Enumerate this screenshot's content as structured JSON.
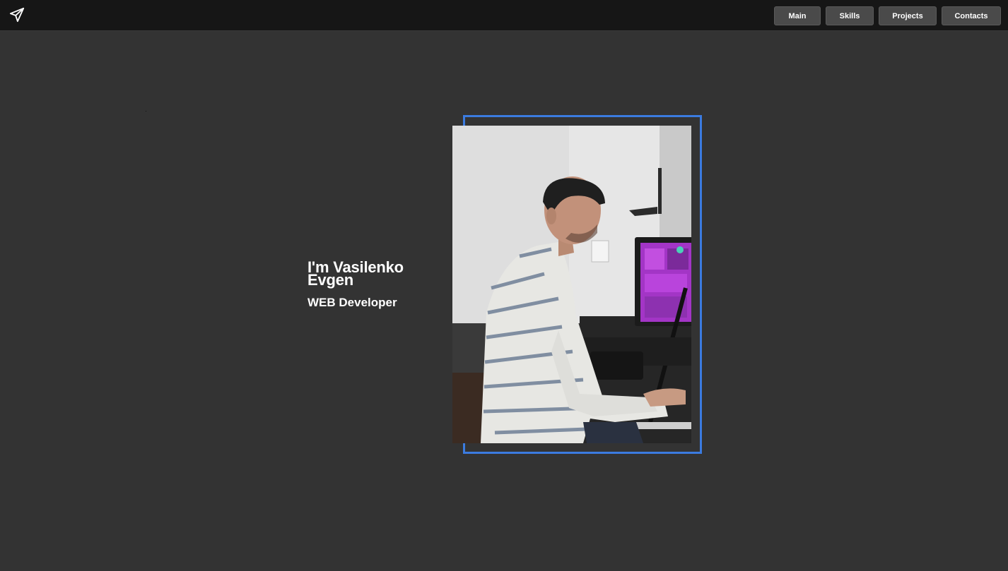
{
  "header": {
    "logo_icon": "paper-plane-icon",
    "nav": [
      {
        "label": "Main"
      },
      {
        "label": "Skills"
      },
      {
        "label": "Projects"
      },
      {
        "label": "Contacts"
      }
    ]
  },
  "hero": {
    "name": "I'm Vasilenko Evgen",
    "role": "WEB Developer"
  },
  "colors": {
    "background": "#333333",
    "topbar": "#161616",
    "button": "#4a4a4a",
    "accent_frame": "#3b7be0",
    "text": "#ffffff"
  }
}
